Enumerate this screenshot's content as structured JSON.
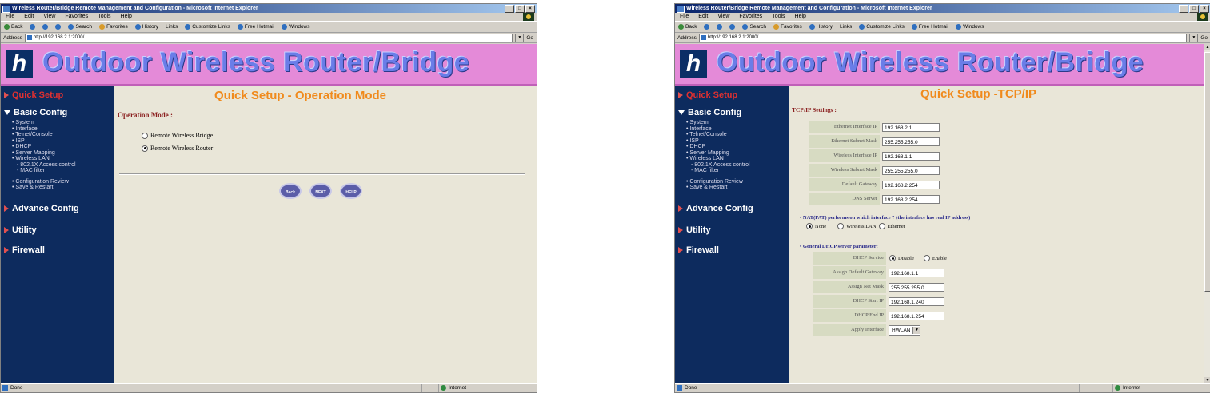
{
  "window1": {
    "title": "Wireless Router/Bridge Remote Management and Configuration - Microsoft Internet Explorer",
    "menu": [
      "File",
      "Edit",
      "View",
      "Favorites",
      "Tools",
      "Help"
    ],
    "toolbar": [
      "Back",
      "Stop",
      "Refresh",
      "Home",
      "Search",
      "Favorites",
      "History",
      "Links",
      "Customize Links",
      "Free Hotmail",
      "Windows"
    ],
    "address_label": "Address",
    "address": "http://192.168.2.1:2000/",
    "go_label": "Go",
    "banner_title": "Outdoor Wireless Router/Bridge",
    "logo_glyph": "h",
    "sidebar": {
      "quick_setup": "Quick Setup",
      "basic_config": "Basic Config",
      "basic_items": [
        "System",
        "Interface",
        "Telnet/Console",
        "ISP",
        "DHCP",
        "Server Mapping",
        "Wireless LAN"
      ],
      "wireless_sub": [
        "802.1X Access control",
        "MAC filter"
      ],
      "extra_items": [
        "Configuration Review",
        "Save & Restart"
      ],
      "advance_config": "Advance Config",
      "utility": "Utility",
      "firewall": "Firewall"
    },
    "page_title": "Quick Setup - Operation Mode",
    "section_label": "Operation Mode :",
    "options": [
      "Remote Wireless Bridge",
      "Remote Wireless Router"
    ],
    "buttons": {
      "back": "Back",
      "next": "NEXT",
      "help": "HELP"
    },
    "status": {
      "left": "Done",
      "zone": "Internet"
    }
  },
  "window2": {
    "title": "Wireless Router/Bridge Remote Management and Configuration - Microsoft Internet Explorer",
    "menu": [
      "File",
      "Edit",
      "View",
      "Favorites",
      "Tools",
      "Help"
    ],
    "toolbar": [
      "Back",
      "Stop",
      "Refresh",
      "Home",
      "Search",
      "Favorites",
      "History",
      "Links",
      "Customize Links",
      "Free Hotmail",
      "Windows"
    ],
    "address_label": "Address",
    "address": "http://192.168.2.1:2000/",
    "go_label": "Go",
    "banner_title": "Outdoor Wireless Router/Bridge",
    "logo_glyph": "h",
    "sidebar": {
      "quick_setup": "Quick Setup",
      "basic_config": "Basic Config",
      "basic_items": [
        "System",
        "Interface",
        "Telnet/Console",
        "ISP",
        "DHCP",
        "Server Mapping",
        "Wireless LAN"
      ],
      "wireless_sub": [
        "802.1X Access control",
        "MAC filter"
      ],
      "extra_items": [
        "Configuration Review",
        "Save & Restart"
      ],
      "advance_config": "Advance Config",
      "utility": "Utility",
      "firewall": "Firewall"
    },
    "page_title": "Quick Setup -TCP/IP",
    "section_label": "TCP/IP Settings :",
    "tcpip_fields": [
      {
        "label": "Ethernet Interface IP",
        "value": "192.168.2.1"
      },
      {
        "label": "Ethernet Subnet Mask",
        "value": "255.255.255.0"
      },
      {
        "label": "Wireless Interface IP",
        "value": "192.168.1.1"
      },
      {
        "label": "Wireless Subnet Mask",
        "value": "255.255.255.0"
      },
      {
        "label": "Default Gateway",
        "value": "192.168.2.254"
      },
      {
        "label": "DNS Server",
        "value": "192.168.2.254"
      }
    ],
    "nat_question": "NAT(PAT) performs on which interface ? (the interface has real IP address)",
    "nat_options": [
      "None",
      "Wireless LAN",
      "Ethernet"
    ],
    "dhcp_heading": "General DHCP server parameter:",
    "dhcp_service_label": "DHCP Service",
    "dhcp_service_options": [
      "Disable",
      "Enable"
    ],
    "dhcp_fields": [
      {
        "label": "Assign Default Gateway",
        "value": "192.168.1.1"
      },
      {
        "label": "Assign Net Mask",
        "value": "255.255.255.0"
      },
      {
        "label": "DHCP Start IP",
        "value": "192.168.1.240"
      },
      {
        "label": "DHCP End IP",
        "value": "192.168.1.254"
      }
    ],
    "apply_interface_label": "Apply Interface",
    "apply_interface_value": "HWLAN",
    "status": {
      "left": "Done",
      "zone": "Internet"
    }
  }
}
